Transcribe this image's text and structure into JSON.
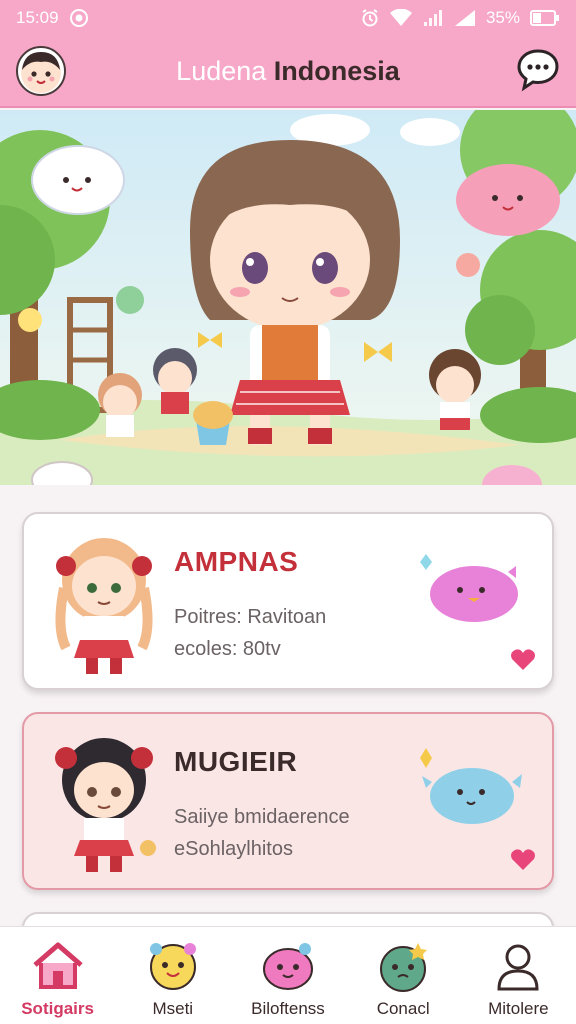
{
  "status_bar": {
    "time": "15:09",
    "battery": "35%"
  },
  "header": {
    "title_part1": "Ludena",
    "title_part2": "Indonesia",
    "profile_icon": "avatar",
    "chat_icon": "chat-bubble-icon"
  },
  "cards": [
    {
      "name": "AMPNAS",
      "line1": "Poitres: Ravitoan",
      "line2": "ecoles: 80tv"
    },
    {
      "name": "MUGIEIR",
      "line1": "Saiiye bmidaerence",
      "line2": "eSohlaylhitos"
    }
  ],
  "nav": {
    "items": [
      {
        "label": "Sotigairs",
        "icon": "home-icon"
      },
      {
        "label": "Mseti",
        "icon": "yellow-pet-icon"
      },
      {
        "label": "Biloftenss",
        "icon": "pink-pet-icon"
      },
      {
        "label": "Conacl",
        "icon": "green-pet-icon"
      },
      {
        "label": "Mitolere",
        "icon": "person-icon"
      }
    ],
    "active_index": 0
  },
  "colors": {
    "header_pink": "#f7a8c8",
    "accent_red": "#c4303a",
    "heart_pink": "#e8457a"
  }
}
